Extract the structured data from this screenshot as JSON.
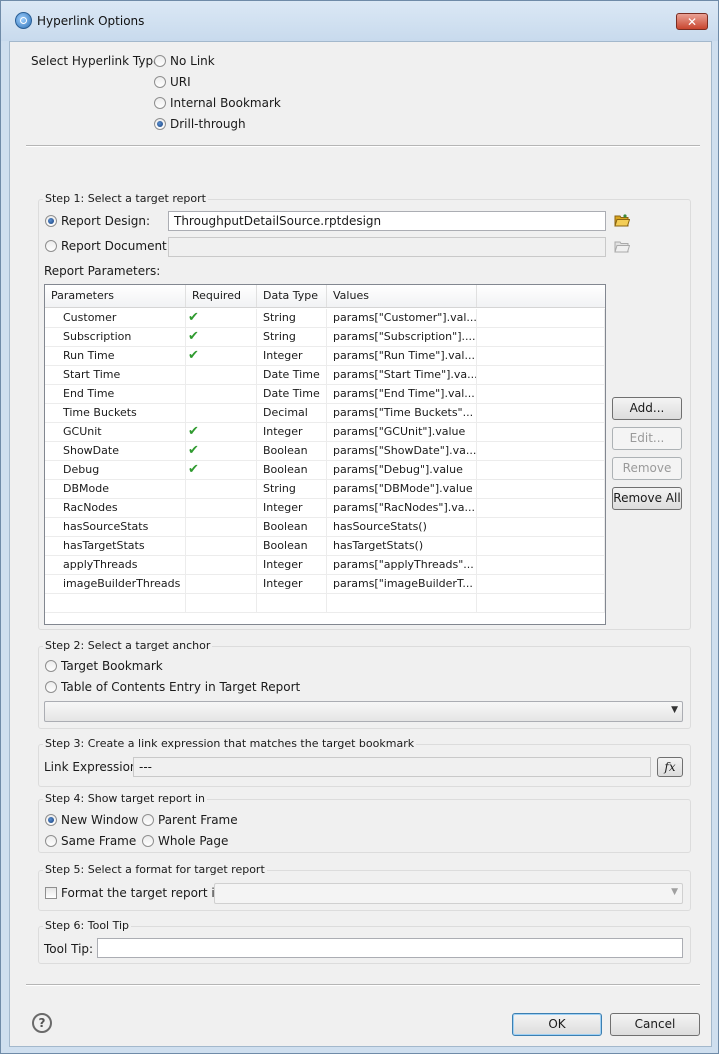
{
  "window": {
    "title": "Hyperlink Options",
    "close_glyph": "✕"
  },
  "hyperlink_type": {
    "label": "Select Hyperlink Type:",
    "options": [
      "No Link",
      "URI",
      "Internal Bookmark",
      "Drill-through"
    ],
    "selected": "Drill-through"
  },
  "step1": {
    "title": "Step 1: Select a target report",
    "report_design_label": "Report Design:",
    "report_design_value": "ThroughputDetailSource.rptdesign",
    "report_document_label": "Report Document:",
    "report_document_value": "",
    "selected": "Report Design",
    "params_label": "Report Parameters:",
    "columns": [
      "Parameters",
      "Required",
      "Data Type",
      "Values"
    ],
    "rows": [
      {
        "name": "Customer",
        "required": true,
        "type": "String",
        "value": "params[\"Customer\"].val..."
      },
      {
        "name": "Subscription",
        "required": true,
        "type": "String",
        "value": "params[\"Subscription\"]...."
      },
      {
        "name": "Run Time",
        "required": true,
        "type": "Integer",
        "value": "params[\"Run Time\"].val..."
      },
      {
        "name": "Start Time",
        "required": false,
        "type": "Date Time",
        "value": "params[\"Start Time\"].va..."
      },
      {
        "name": "End Time",
        "required": false,
        "type": "Date Time",
        "value": "params[\"End Time\"].val..."
      },
      {
        "name": "Time Buckets",
        "required": false,
        "type": "Decimal",
        "value": "params[\"Time Buckets\"..."
      },
      {
        "name": "GCUnit",
        "required": true,
        "type": "Integer",
        "value": "params[\"GCUnit\"].value"
      },
      {
        "name": "ShowDate",
        "required": true,
        "type": "Boolean",
        "value": "params[\"ShowDate\"].va..."
      },
      {
        "name": "Debug",
        "required": true,
        "type": "Boolean",
        "value": "params[\"Debug\"].value"
      },
      {
        "name": "DBMode",
        "required": false,
        "type": "String",
        "value": "params[\"DBMode\"].value"
      },
      {
        "name": "RacNodes",
        "required": false,
        "type": "Integer",
        "value": "params[\"RacNodes\"].va..."
      },
      {
        "name": "hasSourceStats",
        "required": false,
        "type": "Boolean",
        "value": "hasSourceStats()"
      },
      {
        "name": "hasTargetStats",
        "required": false,
        "type": "Boolean",
        "value": "hasTargetStats()"
      },
      {
        "name": "applyThreads",
        "required": false,
        "type": "Integer",
        "value": "params[\"applyThreads\"..."
      },
      {
        "name": "imageBuilderThreads",
        "required": false,
        "type": "Integer",
        "value": "params[\"imageBuilderT..."
      }
    ],
    "check_glyph": "✔",
    "buttons": {
      "add": "Add...",
      "edit": "Edit...",
      "remove": "Remove",
      "remove_all": "Remove All"
    }
  },
  "step2": {
    "title": "Step 2: Select a target anchor",
    "options": [
      "Target Bookmark",
      "Table of Contents Entry in Target Report"
    ],
    "combo_value": ""
  },
  "step3": {
    "title": "Step 3: Create a link expression that matches the target bookmark",
    "label": "Link Expression:",
    "value": "---",
    "fx_label": "fx"
  },
  "step4": {
    "title": "Step 4: Show target report in",
    "options": [
      "New Window",
      "Parent Frame",
      "Same Frame",
      "Whole Page"
    ],
    "selected": "New Window"
  },
  "step5": {
    "title": "Step 5: Select a format for target report",
    "checkbox_label": "Format the target report in:",
    "checked": false,
    "combo_value": ""
  },
  "step6": {
    "title": "Step 6: Tool Tip",
    "label": "Tool Tip:",
    "value": ""
  },
  "footer": {
    "help": "?",
    "ok": "OK",
    "cancel": "Cancel"
  }
}
